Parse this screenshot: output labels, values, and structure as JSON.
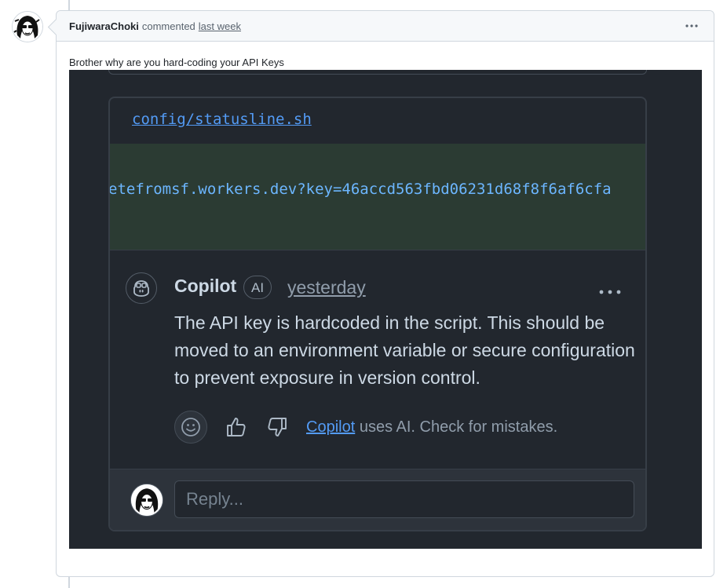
{
  "comment": {
    "author": "FujiwaraChoki",
    "verb": "commented",
    "time": "last week",
    "body": "Brother why are you hard-coding your API Keys"
  },
  "screenshot": {
    "file_path": "config/statusline.sh",
    "code_line": "etefromsf.workers.dev?key=46accd563fbd06231d68f8f6af6cfa",
    "review": {
      "author": "Copilot",
      "badge": "AI",
      "time": "yesterday",
      "text": "The API key is hardcoded in the script. This should be moved to an environment variable or secure configuration to prevent exposure in version control.",
      "disclaimer_link": "Copilot",
      "disclaimer_rest": " uses AI. Check for mistakes."
    },
    "reply_placeholder": "Reply..."
  },
  "icons": {
    "more": "kebab-horizontal-icon",
    "copilot": "copilot-icon",
    "emoji": "smiley-icon",
    "thumbs_up": "thumbs-up-icon",
    "thumbs_down": "thumbs-down-icon"
  },
  "colors": {
    "link": "#539bf5",
    "diff_added_bg": "#2b3b33",
    "dark_bg": "#22272e"
  }
}
